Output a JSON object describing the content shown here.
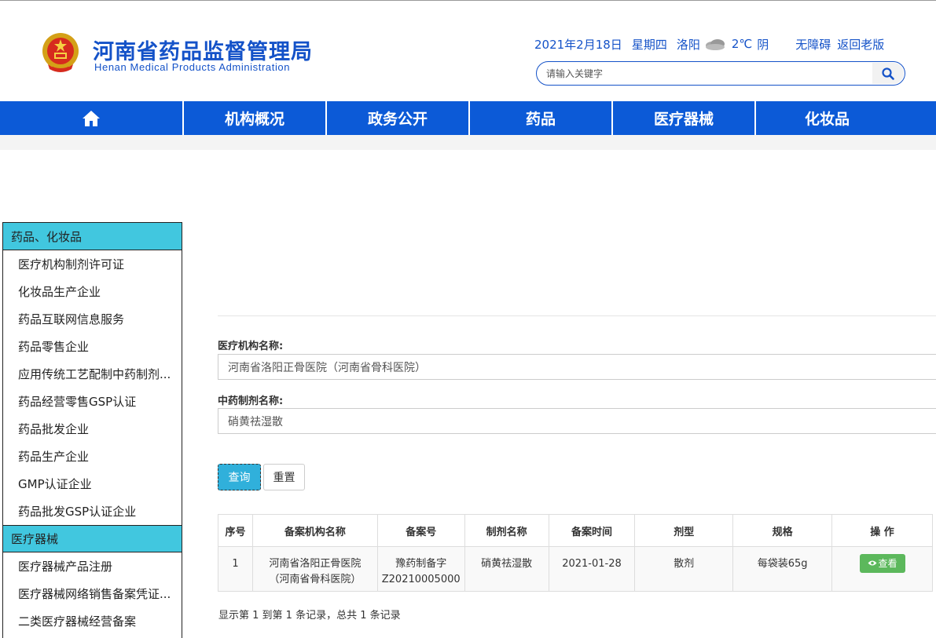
{
  "header": {
    "title": "河南省药品监督管理局",
    "subtitle": "Henan Medical Products Administration",
    "date": "2021年2月18日",
    "weekday": "星期四",
    "city": "洛阳",
    "temperature": "2℃",
    "weather": "阴",
    "accessibility_link": "无障碍",
    "old_version_link": "返回老版",
    "search_placeholder": "请输入关键字"
  },
  "nav": {
    "items": [
      {
        "label": "机构概况"
      },
      {
        "label": "政务公开"
      },
      {
        "label": "药品"
      },
      {
        "label": "医疗器械"
      },
      {
        "label": "化妆品"
      }
    ]
  },
  "sidebar": {
    "section1": "药品、化妆品",
    "items1": [
      "医疗机构制剂许可证",
      "化妆品生产企业",
      "药品互联网信息服务",
      "药品零售企业",
      "应用传统工艺配制中药制剂...",
      "药品经营零售GSP认证",
      "药品批发企业",
      "药品生产企业",
      "GMP认证企业",
      "药品批发GSP认证企业"
    ],
    "section2": "医疗器械",
    "items2": [
      "医疗器械产品注册",
      "医疗器械网络销售备案凭证...",
      "二类医疗器械经营备案"
    ]
  },
  "form": {
    "org_label": "医疗机构名称:",
    "org_value": "河南省洛阳正骨医院（河南省骨科医院）",
    "prep_label": "中药制剂名称:",
    "prep_value": "硝黄祛湿散",
    "query_button": "查询",
    "reset_button": "重置"
  },
  "table": {
    "headers": [
      "序号",
      "备案机构名称",
      "备案号",
      "制剂名称",
      "备案时间",
      "剂型",
      "规格",
      "操 作"
    ],
    "rows": [
      {
        "no": "1",
        "org_line1": "河南省洛阳正骨医院",
        "org_line2": "（河南省骨科医院）",
        "record_line1": "豫药制备字",
        "record_line2": "Z20210005000",
        "prep_name": "硝黄祛湿散",
        "date": "2021-01-28",
        "form": "散剂",
        "spec": "每袋装65g",
        "action": "查看"
      }
    ],
    "summary": "显示第 1 到第 1 条记录，总共 1 条记录"
  }
}
